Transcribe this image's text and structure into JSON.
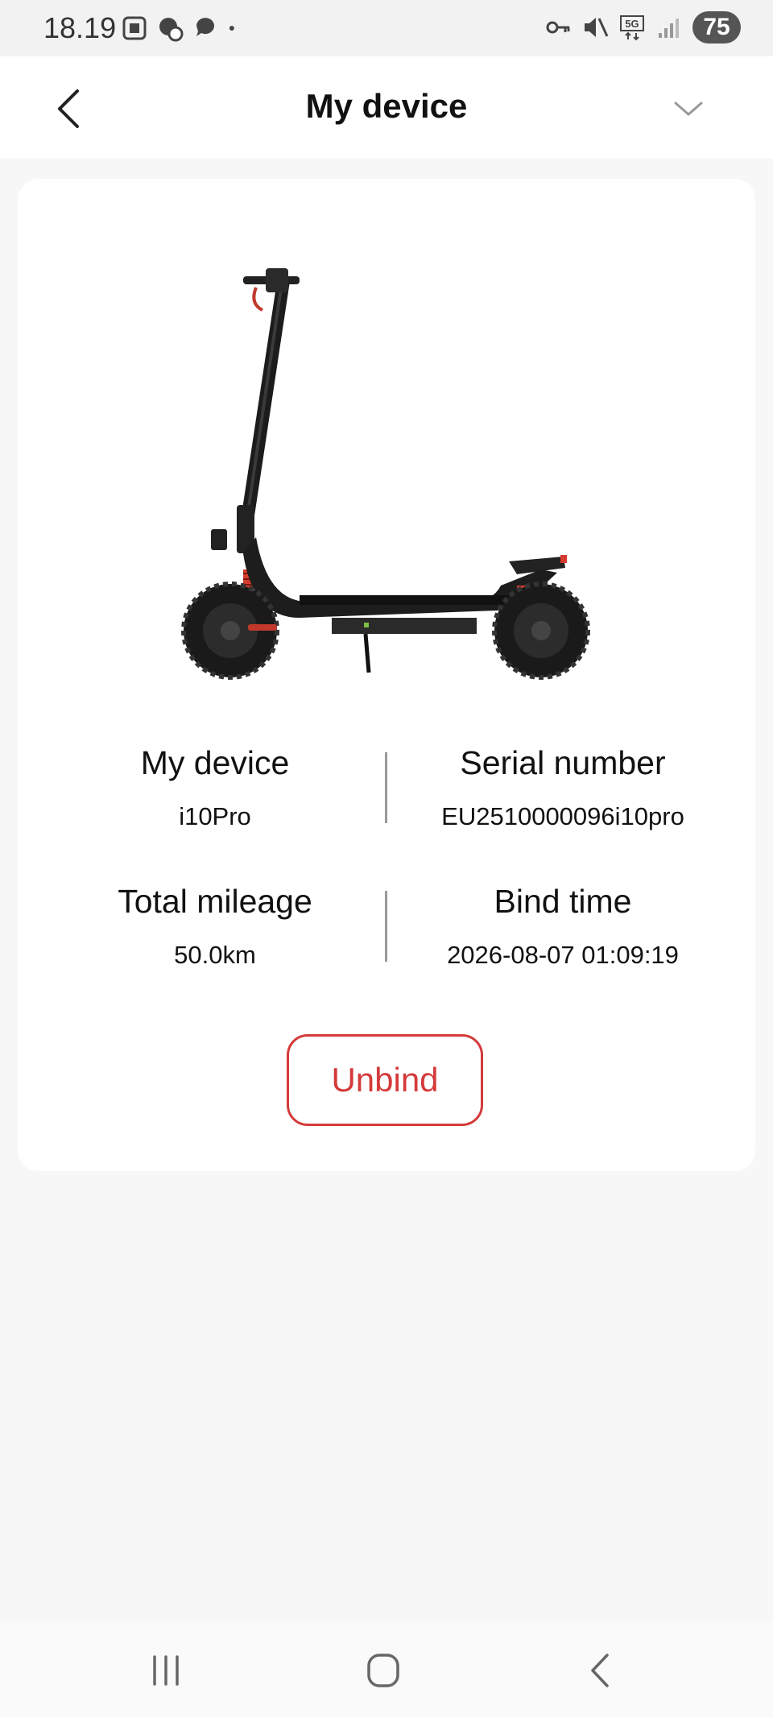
{
  "status_bar": {
    "time": "18.19",
    "battery": "75",
    "network": "5G",
    "left_icons": [
      "screenshot-icon",
      "sync-icon",
      "chat-icon",
      "dot-icon"
    ],
    "right_icons": [
      "vpn-key-icon",
      "mute-icon",
      "network-5g-icon",
      "signal-icon"
    ]
  },
  "header": {
    "title": "My device",
    "back_icon": "chevron-left-icon",
    "dropdown_icon": "chevron-down-icon"
  },
  "device": {
    "image": "scooter-image",
    "fields": [
      {
        "label": "My device",
        "value": "i10Pro"
      },
      {
        "label": "Serial number",
        "value": "EU2510000096i10pro"
      },
      {
        "label": "Total mileage",
        "value": "50.0km"
      },
      {
        "label": "Bind time",
        "value": "2026-08-07 01:09:19"
      }
    ],
    "unbind_label": "Unbind"
  },
  "colors": {
    "accent": "#d43a3a",
    "background": "#f7f7f7",
    "card": "#ffffff"
  },
  "nav_bar": {
    "icons": [
      "recent-apps-icon",
      "home-icon",
      "back-icon"
    ]
  }
}
